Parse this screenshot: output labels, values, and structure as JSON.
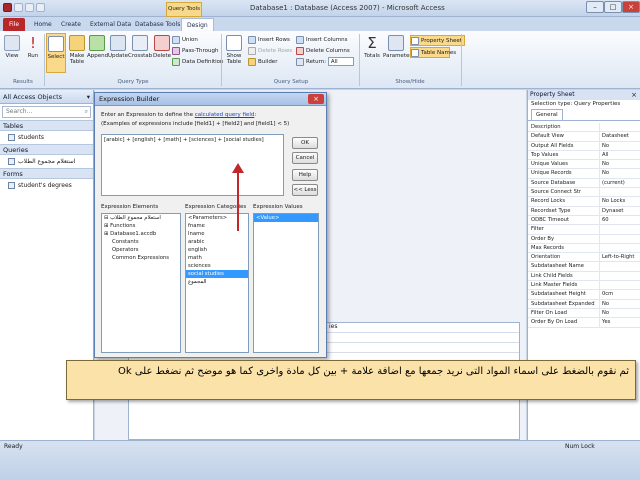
{
  "window": {
    "title": "Database1 : Database (Access 2007)  -  Microsoft Access",
    "context_tab": "Query Tools"
  },
  "tabs": [
    "File",
    "Home",
    "Create",
    "External Data",
    "Database Tools",
    "Design"
  ],
  "ribbon": {
    "results": {
      "label": "Results",
      "view": "View",
      "run": "Run"
    },
    "query_type": {
      "label": "Query Type",
      "select": "Select",
      "make_table": "Make Table",
      "append": "Append",
      "update": "Update",
      "crosstab": "Crosstab",
      "delete": "Delete",
      "union": "Union",
      "pass_through": "Pass-Through",
      "data_definition": "Data Definition"
    },
    "query_setup": {
      "label": "Query Setup",
      "show_table": "Show Table",
      "insert_rows": "Insert Rows",
      "delete_rows": "Delete Rows",
      "builder": "Builder",
      "insert_columns": "Insert Columns",
      "delete_columns": "Delete Columns",
      "return_label": "Return:",
      "return_value": "All"
    },
    "show_hide": {
      "label": "Show/Hide",
      "totals": "Totals",
      "parameters": "Parameters",
      "property_sheet": "Property Sheet",
      "table_names": "Table Names"
    }
  },
  "nav": {
    "header": "All Access Objects",
    "search_placeholder": "Search...",
    "tables_label": "Tables",
    "tables": [
      "students"
    ],
    "queries_label": "Queries",
    "queries": [
      "استعلام مجموع الطلاب"
    ],
    "forms_label": "Forms",
    "forms": [
      "student's degrees"
    ]
  },
  "dialog": {
    "title": "Expression Builder",
    "prompt_prefix": "Enter an Expression to define the ",
    "prompt_link": "calculated query field",
    "prompt_suffix": ":",
    "example": "(Examples of expressions include [field1] + [field2] and [field1] < 5)",
    "expression": "[arabic] + [english] + [math] + [sciences] + [social studies]",
    "buttons": {
      "ok": "OK",
      "cancel": "Cancel",
      "help": "Help",
      "less": "<< Less"
    },
    "elements_label": "Expression Elements",
    "elements": [
      "استعلام مجموع الطلاب",
      "Functions",
      "Database1.accdb",
      "Constants",
      "Operators",
      "Common Expressions"
    ],
    "categories_label": "Expression Categories",
    "categories": [
      "<Parameters>",
      "fname",
      "lname",
      "arabic",
      "english",
      "math",
      "sciences",
      "social studies",
      "المجموع"
    ],
    "selected_category": "social studies",
    "values_label": "Expression Values",
    "values": [
      "<Value>"
    ]
  },
  "grid": {
    "hint": "ies"
  },
  "property_sheet": {
    "title": "Property Sheet",
    "selection_type_label": "Selection type:",
    "selection_type": "Query Properties",
    "tab": "General",
    "rows": [
      [
        "Description",
        ""
      ],
      [
        "Default View",
        "Datasheet"
      ],
      [
        "Output All Fields",
        "No"
      ],
      [
        "Top Values",
        "All"
      ],
      [
        "Unique Values",
        "No"
      ],
      [
        "Unique Records",
        "No"
      ],
      [
        "Source Database",
        "(current)"
      ],
      [
        "Source Connect Str",
        ""
      ],
      [
        "Record Locks",
        "No Locks"
      ],
      [
        "Recordset Type",
        "Dynaset"
      ],
      [
        "ODBC Timeout",
        "60"
      ],
      [
        "Filter",
        ""
      ],
      [
        "Order By",
        ""
      ],
      [
        "Max Records",
        ""
      ],
      [
        "Orientation",
        "Left-to-Right"
      ],
      [
        "Subdatasheet Name",
        ""
      ],
      [
        "Link Child Fields",
        ""
      ],
      [
        "Link Master Fields",
        ""
      ],
      [
        "Subdatasheet Height",
        "0cm"
      ],
      [
        "Subdatasheet Expanded",
        "No"
      ],
      [
        "Filter On Load",
        "No"
      ],
      [
        "Order By On Load",
        "Yes"
      ]
    ]
  },
  "caption": "ثم نقوم بالضغط على اسماء المواد التى نريد جمعها مع اضافة علامة + بين كل مادة واخرى كما هو موضح ثم نضغط على Ok",
  "status": {
    "left": "Ready",
    "right": "Num Lock"
  },
  "colors": {
    "file_tab": "#b8282a",
    "caption_bg": "#fbe2a9",
    "arrow": "#c0282b",
    "selection": "#3399ff"
  }
}
